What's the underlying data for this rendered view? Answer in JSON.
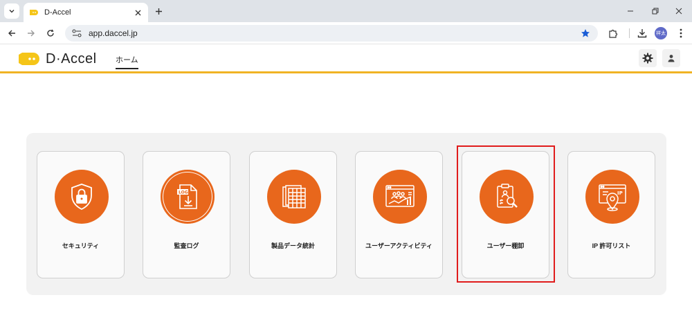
{
  "browser": {
    "tab": {
      "title": "D-Accel"
    },
    "address": {
      "url": "app.daccel.jp"
    },
    "profile": {
      "initials": "祥太"
    }
  },
  "app": {
    "logo_text": "D·Accel",
    "nav": {
      "home_label": "ホーム"
    }
  },
  "cards": [
    {
      "label": "セキュリティ",
      "icon": "shield-lock-icon"
    },
    {
      "label": "監査ログ",
      "icon": "log-download-icon"
    },
    {
      "label": "製品データ統計",
      "icon": "spreadsheet-icon"
    },
    {
      "label": "ユーザーアクティビティ",
      "icon": "activity-dashboard-icon"
    },
    {
      "label": "ユーザー棚卸",
      "icon": "clipboard-user-search-icon"
    },
    {
      "label": "IP 許可リスト",
      "icon": "ip-location-icon"
    }
  ],
  "colors": {
    "accent": "#e8671c",
    "header_underline": "#f0b323",
    "highlight": "#e01b1b",
    "logo_yellow": "#f5c518"
  }
}
